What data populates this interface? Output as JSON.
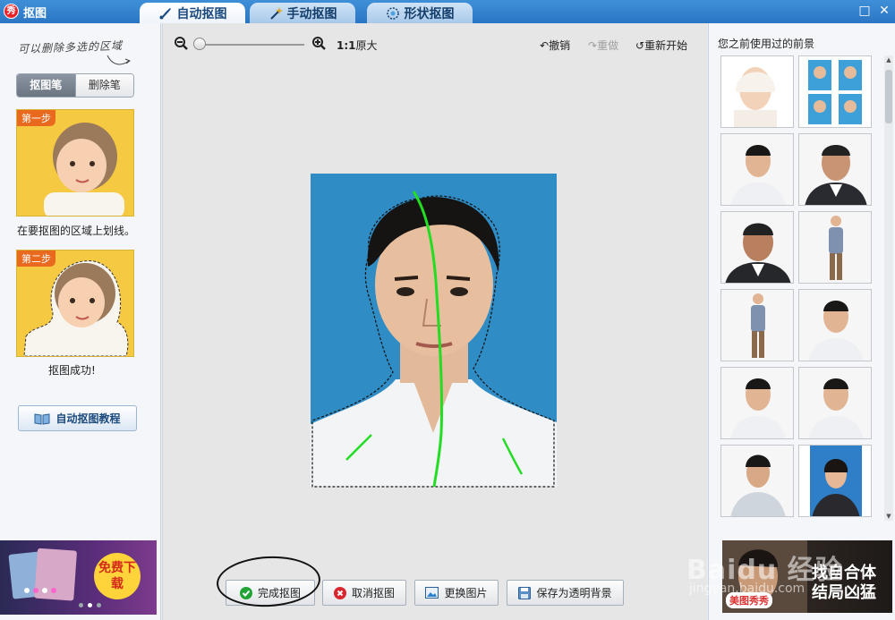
{
  "app": {
    "logo_text": "秀",
    "title": "抠图"
  },
  "tabs": [
    {
      "label": "自动抠图",
      "icon": "brush-icon",
      "active": true
    },
    {
      "label": "手动抠图",
      "icon": "magic-wand-icon",
      "active": false
    },
    {
      "label": "形状抠图",
      "icon": "shape-icon",
      "active": false
    }
  ],
  "window": {
    "maximize_glyph": "□",
    "close_glyph": "✕"
  },
  "left": {
    "hint": "可以删除多选的区域",
    "pen_tabs": [
      {
        "label": "抠图笔",
        "selected": true
      },
      {
        "label": "删除笔",
        "selected": false
      }
    ],
    "step1": {
      "badge": "第一步",
      "caption": "在要抠图的区域上划线。"
    },
    "step2": {
      "badge": "第二步",
      "caption": "抠图成功!"
    },
    "tutorial_button": "自动抠图教程",
    "ad": {
      "text": "免费下载"
    }
  },
  "toolbar": {
    "ratio_bold": "1:1",
    "ratio_label": "原大",
    "undo": "撤销",
    "redo": "重做",
    "restart": "重新开始"
  },
  "actions": {
    "finish": "完成抠图",
    "cancel": "取消抠图",
    "replace": "更换图片",
    "save_transparent": "保存为透明背景"
  },
  "right": {
    "title": "您之前使用过的前景",
    "ad": {
      "caption_line1": "找自合体",
      "caption_line2": "结局凶猛",
      "brand": "美图秀秀"
    }
  },
  "watermark": {
    "line1": "Baidu 经验",
    "line2": "jingyan.baidu.com"
  },
  "colors": {
    "accent": "#2a76c4",
    "finish_icon": "#21a336",
    "cancel_icon": "#d9262e",
    "selection_line": "#22dd22"
  }
}
